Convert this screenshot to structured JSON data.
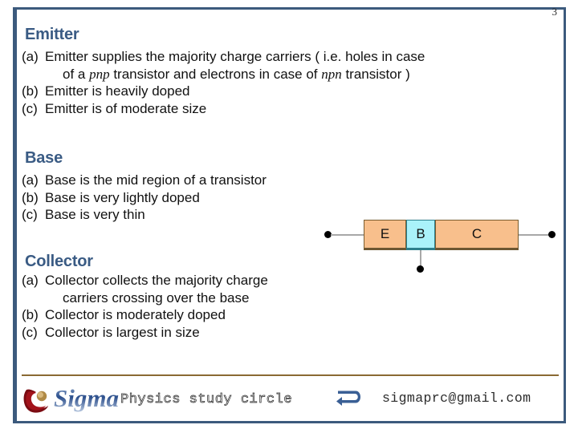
{
  "slide": {
    "page_number": "3",
    "accent_border_color": "#3C5A7D",
    "heading_color": "#3A5B84",
    "rule_color": "#8A6A33"
  },
  "sections": [
    {
      "heading": "Emitter",
      "items": [
        {
          "marker": "(a)",
          "lines": [
            {
              "parts": [
                {
                  "text": "Emitter supplies the majority charge carriers ( i.e. holes in case",
                  "style": "normal"
                }
              ]
            },
            {
              "indent": true,
              "parts": [
                {
                  "text": "of a ",
                  "style": "normal"
                },
                {
                  "text": "pnp",
                  "style": "italic"
                },
                {
                  "text": " transistor and electrons in case of ",
                  "style": "normal"
                },
                {
                  "text": "npn",
                  "style": "italic"
                },
                {
                  "text": " transistor )",
                  "style": "normal"
                }
              ]
            }
          ]
        },
        {
          "marker": "(b)",
          "lines": [
            {
              "parts": [
                {
                  "text": "Emitter is heavily doped",
                  "style": "normal"
                }
              ]
            }
          ]
        },
        {
          "marker": "(c)",
          "lines": [
            {
              "parts": [
                {
                  "text": "Emitter is of moderate size",
                  "style": "normal"
                }
              ]
            }
          ]
        }
      ]
    },
    {
      "heading": "Base",
      "items": [
        {
          "marker": "(a)",
          "lines": [
            {
              "parts": [
                {
                  "text": "Base is the mid region of a transistor",
                  "style": "normal"
                }
              ]
            }
          ]
        },
        {
          "marker": "(b)",
          "lines": [
            {
              "parts": [
                {
                  "text": "Base is very lightly doped",
                  "style": "normal"
                }
              ]
            }
          ]
        },
        {
          "marker": "(c)",
          "lines": [
            {
              "parts": [
                {
                  "text": "Base is very thin",
                  "style": "normal"
                }
              ]
            }
          ]
        }
      ]
    },
    {
      "heading": "Collector",
      "items": [
        {
          "marker": "(a)",
          "lines": [
            {
              "parts": [
                {
                  "text": "Collector  collects the majority charge",
                  "style": "normal"
                }
              ]
            },
            {
              "indent": true,
              "parts": [
                {
                  "text": "carriers crossing over the base",
                  "style": "normal"
                }
              ]
            }
          ]
        },
        {
          "marker": "(b)",
          "lines": [
            {
              "parts": [
                {
                  "text": "Collector is moderately doped",
                  "style": "normal"
                }
              ]
            }
          ]
        },
        {
          "marker": "(c)",
          "lines": [
            {
              "parts": [
                {
                  "text": "Collector is largest in size",
                  "style": "normal"
                }
              ]
            }
          ]
        }
      ]
    }
  ],
  "diagram": {
    "name": "transistor-block-diagram",
    "regions": [
      {
        "label": "E",
        "name": "emitter",
        "color": "#F8BF8C"
      },
      {
        "label": "B",
        "name": "base",
        "color": "#AAF2FA"
      },
      {
        "label": "C",
        "name": "collector",
        "color": "#F8BF8C"
      }
    ],
    "terminals": [
      "emitter-terminal",
      "base-terminal",
      "collector-terminal"
    ]
  },
  "footer": {
    "logo_word": "Sigma",
    "tagline": "Physics study circle",
    "email": "sigmaprc@gmail.com",
    "arrow_icon": "curved-arrow-icon",
    "logo_icon": "sigma-swoosh-logo"
  }
}
